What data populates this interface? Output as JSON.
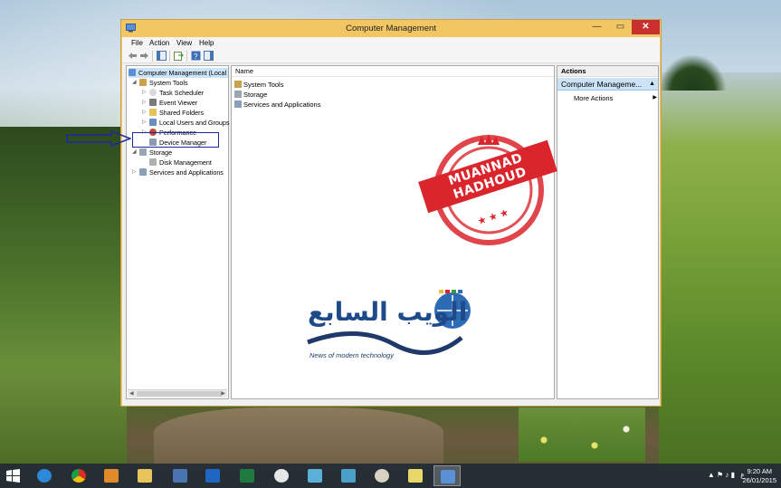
{
  "window": {
    "title": "Computer Management",
    "controls": {
      "minimize": "—",
      "maximize": "▭",
      "close": "✕"
    }
  },
  "menu": [
    "File",
    "Action",
    "View",
    "Help"
  ],
  "tree": {
    "root": "Computer Management (Local",
    "items": [
      {
        "label": "System Tools",
        "level": 1,
        "expander": "◢"
      },
      {
        "label": "Task Scheduler",
        "level": 2,
        "expander": "▷"
      },
      {
        "label": "Event Viewer",
        "level": 2,
        "expander": "▷"
      },
      {
        "label": "Shared Folders",
        "level": 2,
        "expander": "▷"
      },
      {
        "label": "Local Users and Groups",
        "level": 2,
        "expander": "▷"
      },
      {
        "label": "Performance",
        "level": 2,
        "expander": "▷"
      },
      {
        "label": "Device Manager",
        "level": 2,
        "expander": ""
      },
      {
        "label": "Storage",
        "level": 1,
        "expander": "◢"
      },
      {
        "label": "Disk Management",
        "level": 2,
        "expander": ""
      },
      {
        "label": "Services and Applications",
        "level": 1,
        "expander": "▷"
      }
    ]
  },
  "list": {
    "column": "Name",
    "rows": [
      "System Tools",
      "Storage",
      "Services and Applications"
    ]
  },
  "actions": {
    "header": "Actions",
    "section": "Computer Manageme...",
    "items": [
      "More Actions"
    ]
  },
  "stamp": {
    "text": "MUANNAD HADHOUD",
    "stars": "★ ★ ★"
  },
  "logo": {
    "arabic": "الويب السابع",
    "subtitle": "News of modern technology"
  },
  "taskbar": {
    "tray_lang": "ع",
    "time": "9:20 AM",
    "date": "26/01/2015"
  },
  "colors": {
    "titlebar": "#f2c663",
    "close": "#c7302c",
    "selection": "#cbe3f6",
    "annotation": "#1b2a9e",
    "stamp": "#d9252b"
  }
}
